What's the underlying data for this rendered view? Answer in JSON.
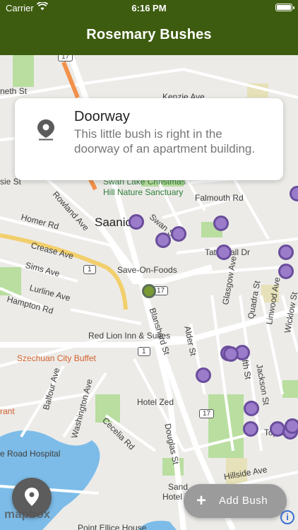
{
  "status_bar": {
    "carrier": "Carrier",
    "time": "6:16 PM"
  },
  "nav": {
    "title": "Rosemary Bushes"
  },
  "callout": {
    "title": "Doorway",
    "description": "This little bush is right in the doorway of an apartment building.",
    "icon": "location-pin-icon"
  },
  "map": {
    "labels": {
      "neth_st": "neth St",
      "kenzie_ave": "Kenzie Ave",
      "sie_st": "sie St",
      "swan_lake": "Swan Lake Christmas",
      "hill_nature": "Hill Nature Sanctuary",
      "falmouth": "Falmouth Rd",
      "rowland": "Rowland Ave",
      "homer": "Homer Rd",
      "saanich": "Saanich",
      "swan_st": "Swan St",
      "crease": "Crease Ave",
      "tattersall": "Tattersall Dr",
      "sims": "Sims Ave",
      "save_on_foods": "Save-On-Foods",
      "lurline": "Lurline Ave",
      "hampton": "Hampton Rd",
      "blanshard": "Blanshard St",
      "glasgow": "Glasgow Ave",
      "quadra": "Quadra St",
      "linwood": "Linwood Ave",
      "wicklow": "Wicklow St",
      "alder": "Alder St",
      "red_lion": "Red Lion Inn & Suites",
      "szechuan": "Szechuan City Buffet",
      "fifth": "Fifth St",
      "jackson": "Jackson St",
      "balfour": "Balfour Ave",
      "washington": "Washington Ave",
      "hotel_zed": "Hotel Zed",
      "cecelia": "Cecelia Rd",
      "douglas": "Douglas St",
      "rant": "rant",
      "topaz": "Topaz A",
      "hospital": "e Road Hospital",
      "hillside": "Hillside Ave",
      "sand": "Sand",
      "hotel_v": "Hotel V",
      "point_ellice": "Point Ellice House",
      "route_17a": "17",
      "route_17b": "17",
      "route_17c": "17",
      "route_1a": "1",
      "route_1b": "1"
    },
    "pins_count": 18
  },
  "buttons": {
    "add_bush": "Add Bush",
    "locate_icon": "location-marker-icon",
    "mapbox": "mapbox",
    "info": "i"
  },
  "colors": {
    "bar": "#3d5c0f",
    "pin": "#9b7ccb",
    "pin_border": "#6a4d9c",
    "selected_pin": "#7a9a34"
  }
}
